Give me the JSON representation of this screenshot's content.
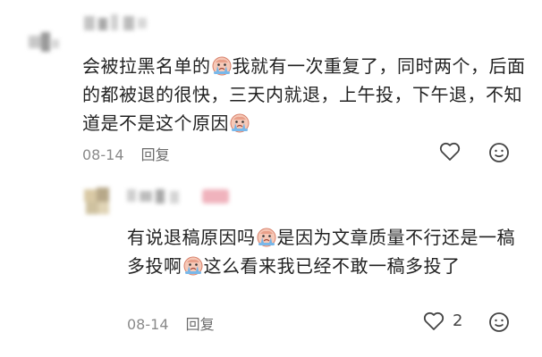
{
  "comment": {
    "text_parts": [
      "会被拉黑名单的",
      "我就有一次重复了，同时两个，后面的都被退的很快，三天内就退，上午投，下午退，不知道是不是这个原因",
      ""
    ],
    "stickers": [
      "crying-emoji",
      "crying-emoji"
    ],
    "date": "08-14",
    "reply_label": "回复"
  },
  "reply": {
    "text_parts": [
      "有说退稿原因吗",
      "是因为文章质量不行还是一稿多投啊",
      "这么看来我已经不敢一稿多投了"
    ],
    "stickers": [
      "crying-emoji",
      "crying-emoji"
    ],
    "date": "08-14",
    "reply_label": "回复",
    "like_count": "2"
  },
  "colors": {
    "text": "#222222",
    "meta": "#8a8a8a",
    "sticker_face": "#f4c5b5",
    "sticker_tears": "#6fb2e6"
  }
}
